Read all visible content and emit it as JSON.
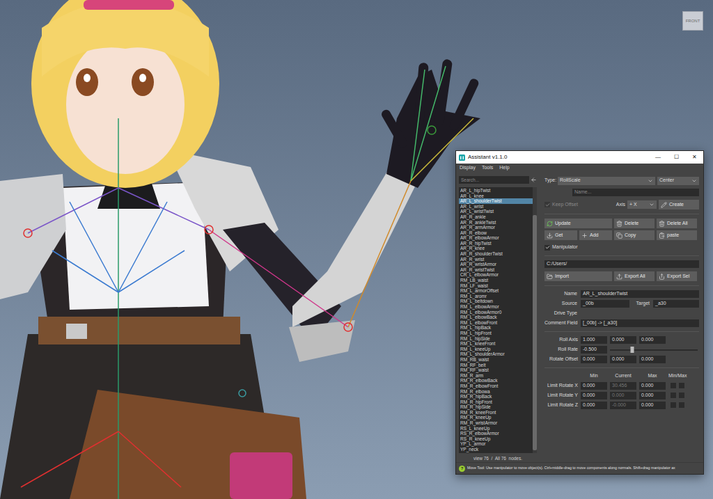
{
  "window": {
    "title": "Assistant v1.1.0",
    "controls": [
      "—",
      "☐",
      "✕"
    ]
  },
  "menu": [
    "Display",
    "Tools",
    "Help"
  ],
  "search": {
    "placeholder": "Search..."
  },
  "node_list": {
    "items": [
      {
        "label": "AR_L_hipTwist",
        "selected": false
      },
      {
        "label": "AR_L_knee",
        "selected": false
      },
      {
        "label": "AR_L_shoulderTwist",
        "selected": true
      },
      {
        "label": "AR_L_wrist",
        "selected": false
      },
      {
        "label": "AR_L_wristTwist",
        "selected": false
      },
      {
        "label": "AR_R_ankle",
        "selected": false
      },
      {
        "label": "AR_R_ankleTwist",
        "selected": false
      },
      {
        "label": "AR_R_armArmor",
        "selected": false
      },
      {
        "label": "AR_R_elbow",
        "selected": false
      },
      {
        "label": "AR_R_elbowArmor",
        "selected": false
      },
      {
        "label": "AR_R_hipTwist",
        "selected": false
      },
      {
        "label": "AR_R_knee",
        "selected": false
      },
      {
        "label": "AR_R_shoulderTwist",
        "selected": false
      },
      {
        "label": "AR_R_wrist",
        "selected": false
      },
      {
        "label": "AR_R_wristArmor",
        "selected": false
      },
      {
        "label": "AR_R_wristTwist",
        "selected": false
      },
      {
        "label": "CR_L_elbowArmor",
        "selected": false
      },
      {
        "label": "RM_LB_waist",
        "selected": false
      },
      {
        "label": "RM_LF_waist",
        "selected": false
      },
      {
        "label": "RM_L_armorOffset",
        "selected": false
      },
      {
        "label": "RM_L_aromr",
        "selected": false
      },
      {
        "label": "RM_L_beltdown",
        "selected": false
      },
      {
        "label": "RM_L_elbowArmor",
        "selected": false
      },
      {
        "label": "RM_L_elbowArmor0",
        "selected": false
      },
      {
        "label": "RM_L_elbowBack",
        "selected": false
      },
      {
        "label": "RM_L_elbowFront",
        "selected": false
      },
      {
        "label": "RM_L_hipBack",
        "selected": false
      },
      {
        "label": "RM_L_hipFront",
        "selected": false
      },
      {
        "label": "RM_L_hipSide",
        "selected": false
      },
      {
        "label": "RM_L_kneeFront",
        "selected": false
      },
      {
        "label": "RM_L_kneeUp",
        "selected": false
      },
      {
        "label": "RM_L_shoulderArmor",
        "selected": false
      },
      {
        "label": "RM_RB_waist",
        "selected": false
      },
      {
        "label": "RM_RF_belt",
        "selected": false
      },
      {
        "label": "RM_RF_waist",
        "selected": false
      },
      {
        "label": "RM_R_arm",
        "selected": false
      },
      {
        "label": "RM_R_elbowBack",
        "selected": false
      },
      {
        "label": "RM_R_elbowFront",
        "selected": false
      },
      {
        "label": "RM_R_elbowa",
        "selected": false
      },
      {
        "label": "RM_R_hipBack",
        "selected": false
      },
      {
        "label": "RM_R_hipFront",
        "selected": false
      },
      {
        "label": "RM_R_hipSide",
        "selected": false
      },
      {
        "label": "RM_R_kneeFront",
        "selected": false
      },
      {
        "label": "RM_R_kneeUp",
        "selected": false
      },
      {
        "label": "RM_R_wristArmor",
        "selected": false
      },
      {
        "label": "RS_L_kneeUp",
        "selected": false
      },
      {
        "label": "RS_R_elbowArmor",
        "selected": false
      },
      {
        "label": "RS_R_kneeUp",
        "selected": false
      },
      {
        "label": "YP_L_armor",
        "selected": false
      },
      {
        "label": "YP_neck",
        "selected": false
      }
    ],
    "footer": "view 76  /  All 76  nodes."
  },
  "type_row": {
    "label": "Type:",
    "type": "RollScale",
    "side": "Center"
  },
  "name_field": {
    "placeholder": "Name..."
  },
  "keep_offset": {
    "label": "Keep Offset",
    "checked": true,
    "disabled": true
  },
  "axis": {
    "label": "Axis",
    "value": "+ X"
  },
  "create_button": "Create",
  "action_buttons": [
    "Update",
    "Delete",
    "Delete All",
    "Get",
    "Add",
    "Copy",
    "paste"
  ],
  "manipulator": {
    "label": "Manipulator",
    "checked": true
  },
  "path": "C:/Users/",
  "io_buttons": [
    "Import",
    "Export All",
    "Export Sel"
  ],
  "info": {
    "name": {
      "label": "Name",
      "value": "AR_L_shoulderTwist"
    },
    "source": {
      "label": "Source",
      "value": "_00b"
    },
    "target": {
      "label": "Target",
      "value": "_a30"
    },
    "drive_type": {
      "label": "Drive Type",
      "value": ""
    },
    "comment": {
      "label": "Comment Field",
      "value": "[_00b] -> [_a30]"
    }
  },
  "roll": {
    "roll_axis": {
      "label": "Roll Axis",
      "values": [
        "1.000",
        "0.000",
        "0.000"
      ]
    },
    "roll_rate": {
      "label": "Roll Rate",
      "value": "-0.500",
      "level": 0.25
    },
    "rotate_offset": {
      "label": "Rotate Offset",
      "values": [
        "0.000",
        "0.000",
        "0.000"
      ]
    }
  },
  "limits": {
    "columns": [
      "Min",
      "Current",
      "Max",
      "Min/Max"
    ],
    "current_disabled": true,
    "rows": [
      {
        "label": "Limit Rotate X",
        "min": "0.000",
        "current": "30.456",
        "max": "0.000",
        "min_checked": false,
        "max_checked": false
      },
      {
        "label": "Limit Rotate Y",
        "min": "0.000",
        "current": "0.000",
        "max": "0.000",
        "min_checked": false,
        "max_checked": false
      },
      {
        "label": "Limit Rotate Z",
        "min": "0.000",
        "current": "-0.000",
        "max": "0.000",
        "min_checked": false,
        "max_checked": false
      }
    ]
  },
  "status_bar": {
    "icon": "?",
    "text": "Move Tool: Use manipulator to move object(s). Ctrl+middle-drag to move components along normals. Shift+drag manipulator ax"
  },
  "viewport": {
    "view_cube": "FRONT"
  }
}
